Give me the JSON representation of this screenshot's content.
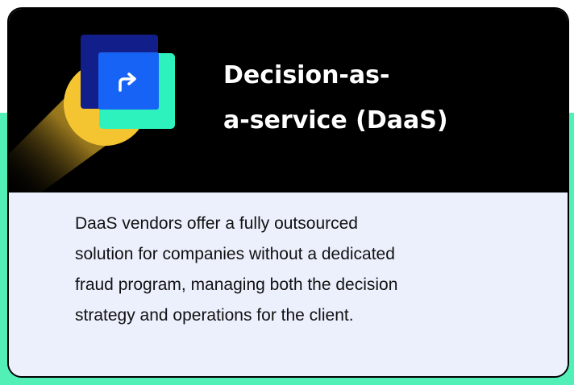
{
  "card": {
    "title_lines": [
      "Decision-as-",
      "a-service (DaaS)"
    ],
    "description_lines": [
      "DaaS vendors offer a fully outsourced",
      "solution for companies without a dedicated",
      "fraud program, managing both the decision",
      "strategy and operations for the client."
    ],
    "icon": "redirect-arrow-icon"
  },
  "colors": {
    "header_background": "#000000",
    "body_background": "#ecf0fd",
    "page_accent": "#52f0b6",
    "icon_navy": "#121e8a",
    "icon_blue": "#1763f5",
    "icon_mint": "#2ef2bd",
    "beam_yellow": "#f5c531"
  }
}
